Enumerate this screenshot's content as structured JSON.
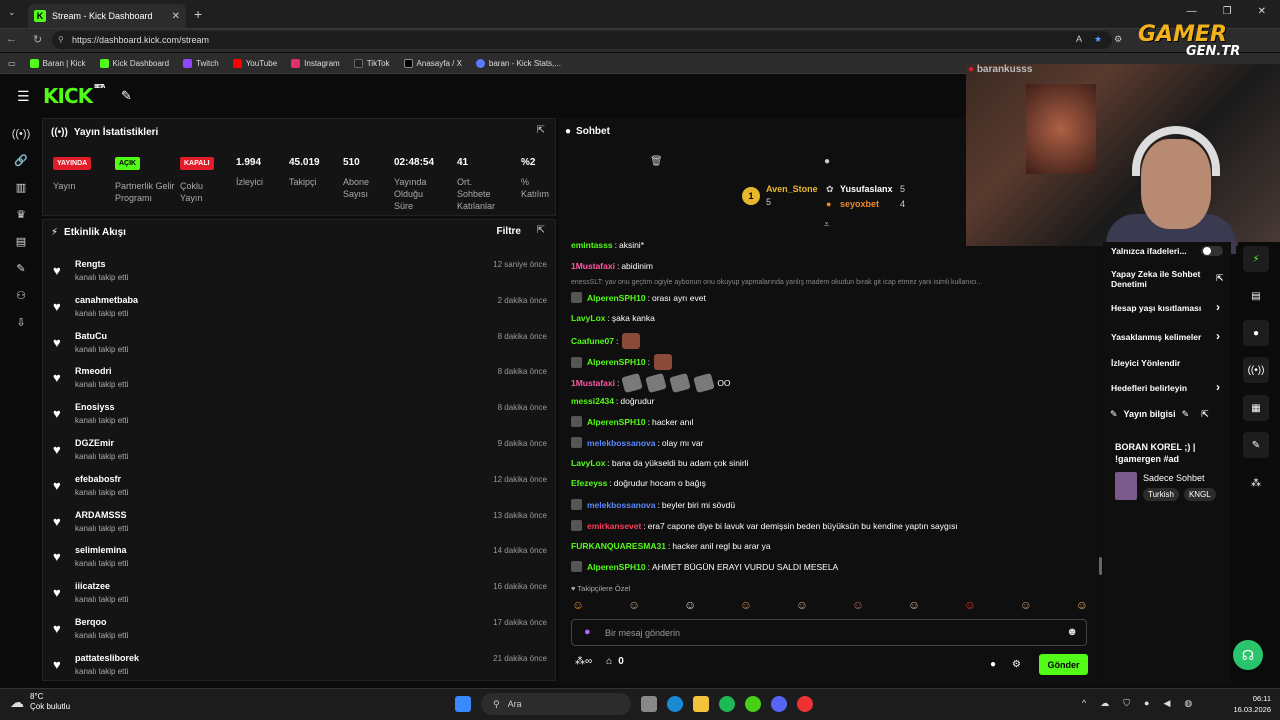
{
  "browser": {
    "tab_title": "Stream - Kick Dashboard",
    "url": "https://dashboard.kick.com/stream",
    "bookmarks": [
      "Baran | Kick",
      "Kick Dashboard",
      "Twitch",
      "YouTube",
      "Instagram",
      "TikTok",
      "Anasayfa / X",
      "baran - Kick Stats,..."
    ]
  },
  "header": {
    "logo": "KICK",
    "logo_sup": "BETA"
  },
  "stats": {
    "title": "Yayın İstatistikleri",
    "items": [
      {
        "badge": "YAYINDA",
        "label": "Yayın"
      },
      {
        "badge": "AÇIK",
        "label": "Partnerlik Gelir Programı"
      },
      {
        "badge": "KAPALI",
        "label": "Çoklu Yayın"
      },
      {
        "value": "1.994",
        "label": "İzleyici"
      },
      {
        "value": "45.019",
        "label": "Takipçi"
      },
      {
        "value": "510",
        "label": "Abone Sayısı"
      },
      {
        "value": "02:48:54",
        "label": "Yayında Olduğu Süre"
      },
      {
        "value": "41",
        "label": "Ort. Sohbete Katılanlar"
      },
      {
        "value": "%2",
        "label": "% Katılım"
      }
    ]
  },
  "activity": {
    "title": "Etkinlik Akışı",
    "filter": "Filtre",
    "sub": "kanalı takip etti",
    "items": [
      {
        "name": "Rengts",
        "time": "12 saniye önce"
      },
      {
        "name": "canahmetbaba",
        "time": "2 dakika önce"
      },
      {
        "name": "BatuCu",
        "time": "8 dakika önce"
      },
      {
        "name": "Rmeodri",
        "time": "8 dakika önce"
      },
      {
        "name": "Enosiyss",
        "time": "8 dakika önce"
      },
      {
        "name": "DGZEmir",
        "time": "9 dakika önce"
      },
      {
        "name": "efebabosfr",
        "time": "12 dakika önce"
      },
      {
        "name": "ARDAMSSS",
        "time": "13 dakika önce"
      },
      {
        "name": "selimlemina",
        "time": "14 dakika önce"
      },
      {
        "name": "iiicatzee",
        "time": "16 dakika önce"
      },
      {
        "name": "Berqoo",
        "time": "17 dakika önce"
      },
      {
        "name": "pattatesliborek",
        "time": "21 dakika önce"
      }
    ]
  },
  "chat": {
    "title": "Sohbet",
    "leaderboard": [
      {
        "name": "Aven_Stone",
        "count": "5"
      },
      {
        "name": "Yusufaslanx",
        "count": "5"
      },
      {
        "name": "seyoxbet",
        "count": "4"
      }
    ],
    "reply_preview": "enessSLT: yav onu geçtim ogiyle aybonun onu okuyup yapmalarında yanlış madem okudun bırak git icap etmez yani isimli kullanıcı...",
    "messages": [
      {
        "user": "emintasss",
        "color": "#53fc18",
        "text": "aksini*"
      },
      {
        "user": "1Mustafaxi",
        "color": "#ff5aa5",
        "text": "abidinim"
      },
      {
        "user": "AlperenSPH10",
        "color": "#53fc18",
        "text": "orası ayrı evet",
        "avatar": true
      },
      {
        "user": "LavyLox",
        "color": "#53fc18",
        "text": "şaka kanka"
      },
      {
        "user": "Caafune07",
        "color": "#53fc18",
        "text": "",
        "emotes": 1
      },
      {
        "user": "AlperenSPH10",
        "color": "#53fc18",
        "text": "",
        "emotes": 1,
        "avatar": true
      },
      {
        "user": "1Mustafaxi",
        "color": "#ff5aa5",
        "text": "OO",
        "emotes": 4,
        "grey": true
      },
      {
        "user": "messi2434",
        "color": "#53fc18",
        "text": "doğrudur"
      },
      {
        "user": "AlperenSPH10",
        "color": "#53fc18",
        "text": "hacker anıl",
        "avatar": true
      },
      {
        "user": "melekbossanova",
        "color": "#5a8aff",
        "text": "olay mı var",
        "avatar": true
      },
      {
        "user": "LavyLox",
        "color": "#53fc18",
        "text": "bana da yükseldi bu adam çok sinirli"
      },
      {
        "user": "Efezeyss",
        "color": "#53fc18",
        "text": "doğrudur hocam o bağış"
      },
      {
        "user": "melekbossanova",
        "color": "#5a8aff",
        "text": "beyler biri mi sövdü",
        "avatar": true
      },
      {
        "user": "emirkansevet",
        "color": "#ff3b5c",
        "text": "era7 capone diye bi lavuk var demişsin beden büyüksün bu kendine yaptın saygısı",
        "avatar": true
      },
      {
        "user": "FURKANQUARESMA31",
        "color": "#53fc18",
        "text": "hacker anil regl bu arar ya"
      },
      {
        "user": "AlperenSPH10",
        "color": "#53fc18",
        "text": "AHMET BÜGÜN ERAYI VURDU SALDI MESELA",
        "avatar": true
      }
    ],
    "followers_only": "Takipçilere Özel",
    "input_placeholder": "Bir mesaj gönderin",
    "points": "0",
    "send": "Gönder"
  },
  "webcam": {
    "name": "barankusss"
  },
  "watermark": {
    "line1": "GAMER",
    "line2": "GEN.TR"
  },
  "right_panel": {
    "items": [
      {
        "label": "Yalnızca ifadeleri..."
      },
      {
        "label": "Yapay Zeka ile Sohbet Denetimi"
      },
      {
        "label": "Hesap yaşı kısıtlaması"
      },
      {
        "label": "Yasaklanmış kelimeler"
      },
      {
        "label": "İzleyici Yönlendir"
      },
      {
        "label": "Hedefleri belirleyin"
      }
    ],
    "info_title": "Yayın bilgisi",
    "stream_title": "BORAN KOREL ;) | !gamergen #ad",
    "category": "Sadece Sohbet",
    "tags": [
      "Turkish",
      "KNGL"
    ]
  },
  "taskbar": {
    "temp": "8°C",
    "weather": "Çok bulutlu",
    "search": "Ara",
    "time": "06:11",
    "date": "16.03.2026"
  }
}
